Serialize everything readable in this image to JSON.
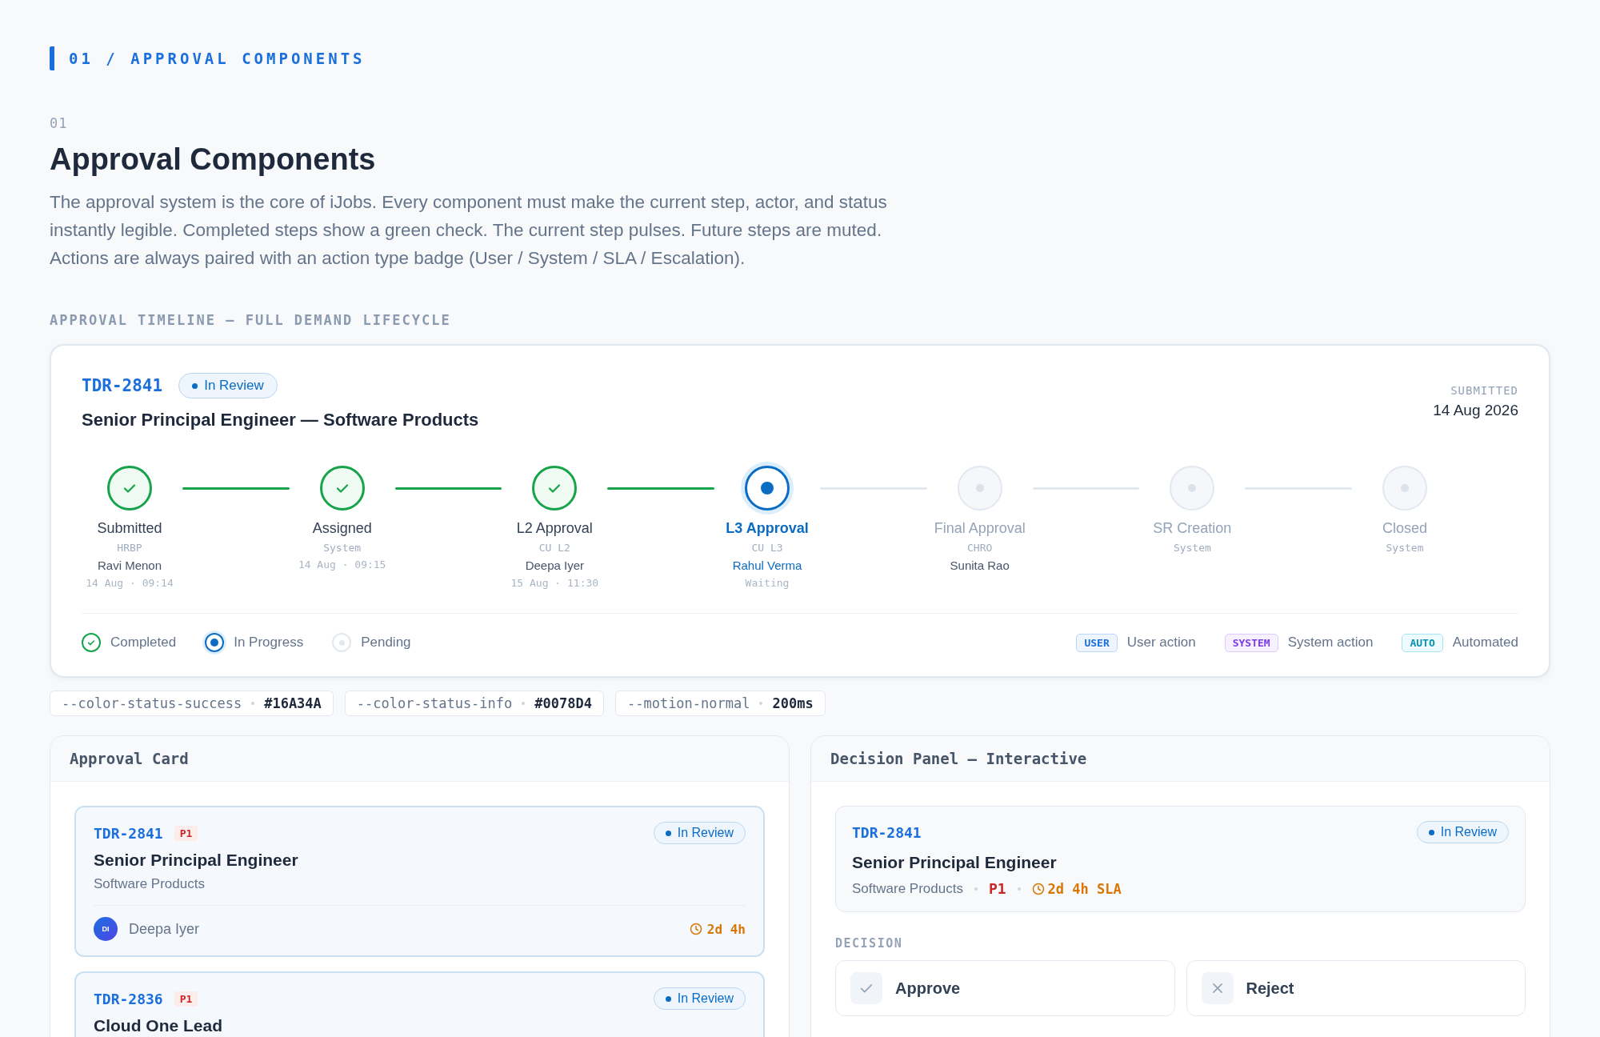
{
  "eyebrow": "01 / APPROVAL COMPONENTS",
  "section_number": "01",
  "title": "Approval Components",
  "intro": "The approval system is the core of iJobs. Every component must make the current step, actor, and status instantly legible. Completed steps show a green check. The current step pulses. Future steps are muted. Actions are always paired with an action type badge (User / System / SLA / Escalation).",
  "timeline_label": "APPROVAL TIMELINE — FULL DEMAND LIFECYCLE",
  "timeline": {
    "id": "TDR-2841",
    "status": "In Review",
    "title": "Senior Principal Engineer — Software Products",
    "submitted_label": "SUBMITTED",
    "submitted_date": "14 Aug 2026",
    "steps": [
      {
        "label": "Submitted",
        "role": "HRBP",
        "actor": "Ravi Menon",
        "time": "14 Aug · 09:14",
        "kind": "done"
      },
      {
        "label": "Assigned",
        "role": "System",
        "time": "14 Aug · 09:15",
        "kind": "done"
      },
      {
        "label": "L2 Approval",
        "role": "CU L2",
        "actor": "Deepa Iyer",
        "time": "15 Aug · 11:30",
        "kind": "done"
      },
      {
        "label": "L3 Approval",
        "role": "CU L3",
        "actor": "Rahul Verma",
        "time": "Waiting",
        "kind": "current"
      },
      {
        "label": "Final Approval",
        "role": "CHRO",
        "actor": "Sunita Rao",
        "kind": "pending"
      },
      {
        "label": "SR Creation",
        "role": "System",
        "kind": "pending"
      },
      {
        "label": "Closed",
        "role": "System",
        "kind": "pending"
      }
    ],
    "legend": [
      {
        "label": "Completed",
        "kind": "done"
      },
      {
        "label": "In Progress",
        "kind": "current"
      },
      {
        "label": "Pending",
        "kind": "pending"
      }
    ],
    "action_types": [
      {
        "badge": "USER",
        "label": "User action",
        "kind": "user"
      },
      {
        "badge": "SYSTEM",
        "label": "System action",
        "kind": "system"
      },
      {
        "badge": "AUTO",
        "label": "Automated",
        "kind": "auto"
      }
    ]
  },
  "tokens": [
    {
      "name": "--color-status-success",
      "value": "#16A34A"
    },
    {
      "name": "--color-status-info",
      "value": "#0078D4"
    },
    {
      "name": "--motion-normal",
      "value": "200ms"
    }
  ],
  "approval_card_panel": {
    "title": "Approval Card",
    "cards": [
      {
        "id": "TDR-2841",
        "priority": "P1",
        "status": "In Review",
        "title": "Senior Principal Engineer",
        "subtitle": "Software Products",
        "owner_initials": "DI",
        "owner": "Deepa Iyer",
        "sla": "2d 4h"
      },
      {
        "id": "TDR-2836",
        "priority": "P1",
        "status": "In Review",
        "title": "Cloud One Lead"
      }
    ]
  },
  "decision_panel": {
    "title": "Decision Panel — Interactive",
    "id": "TDR-2841",
    "status": "In Review",
    "role": "Senior Principal Engineer",
    "unit": "Software Products",
    "priority": "P1",
    "sla": "2d 4h SLA",
    "decision_label": "DECISION",
    "buttons": [
      {
        "label": "Approve",
        "kind": "approve"
      },
      {
        "label": "Reject",
        "kind": "reject"
      }
    ]
  }
}
